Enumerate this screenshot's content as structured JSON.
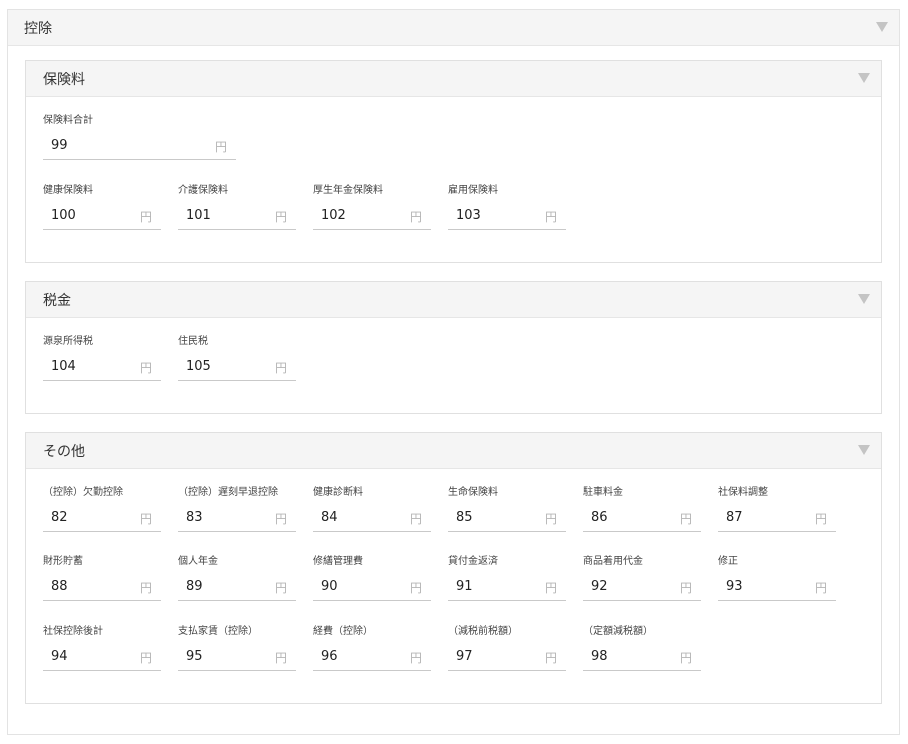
{
  "outer": {
    "title": "控除"
  },
  "panels": [
    {
      "title": "保険料",
      "fields": [
        {
          "label": "保険料合計",
          "value": "99",
          "unit": "円"
        },
        {
          "label": "健康保険料",
          "value": "100",
          "unit": "円"
        },
        {
          "label": "介護保険料",
          "value": "101",
          "unit": "円"
        },
        {
          "label": "厚生年金保険料",
          "value": "102",
          "unit": "円"
        },
        {
          "label": "雇用保険料",
          "value": "103",
          "unit": "円"
        }
      ]
    },
    {
      "title": "税金",
      "fields": [
        {
          "label": "源泉所得税",
          "value": "104",
          "unit": "円"
        },
        {
          "label": "住民税",
          "value": "105",
          "unit": "円"
        }
      ]
    },
    {
      "title": "その他",
      "fields": [
        {
          "label": "（控除）欠勤控除",
          "value": "82",
          "unit": "円"
        },
        {
          "label": "（控除）遅刻早退控除",
          "value": "83",
          "unit": "円"
        },
        {
          "label": "健康診断料",
          "value": "84",
          "unit": "円"
        },
        {
          "label": "生命保険料",
          "value": "85",
          "unit": "円"
        },
        {
          "label": "駐車料金",
          "value": "86",
          "unit": "円"
        },
        {
          "label": "社保料調整",
          "value": "87",
          "unit": "円"
        },
        {
          "label": "財形貯蓄",
          "value": "88",
          "unit": "円"
        },
        {
          "label": "個人年金",
          "value": "89",
          "unit": "円"
        },
        {
          "label": "修繕管理費",
          "value": "90",
          "unit": "円"
        },
        {
          "label": "貸付金返済",
          "value": "91",
          "unit": "円"
        },
        {
          "label": "商品着用代金",
          "value": "92",
          "unit": "円"
        },
        {
          "label": "修正",
          "value": "93",
          "unit": "円"
        },
        {
          "label": "社保控除後計",
          "value": "94",
          "unit": "円"
        },
        {
          "label": "支払家賃（控除）",
          "value": "95",
          "unit": "円"
        },
        {
          "label": "経費（控除）",
          "value": "96",
          "unit": "円"
        },
        {
          "label": "（減税前税額）",
          "value": "97",
          "unit": "円"
        },
        {
          "label": "（定額減税額）",
          "value": "98",
          "unit": "円"
        }
      ]
    }
  ]
}
